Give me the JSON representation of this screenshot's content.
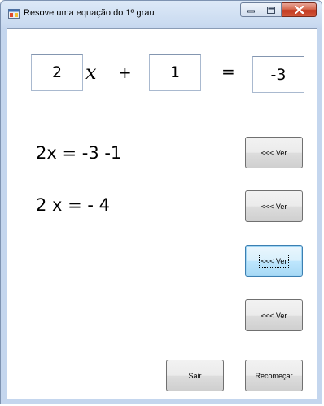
{
  "window": {
    "title": "Resove uma equação do 1º grau"
  },
  "equation": {
    "coefficient": "2",
    "variable": "x",
    "operator": "+",
    "constant": "1",
    "equals": "=",
    "result": "-3"
  },
  "steps": [
    "2x = -3 -1",
    "2 x = - 4"
  ],
  "buttons": {
    "ver_label": "<<< Ver",
    "exit_label": "Sair",
    "restart_label": "Recomeçar"
  },
  "colors": {
    "title_bar": "#c9daf0",
    "close_button": "#c2381f",
    "focus_border": "#3c7fb1"
  }
}
